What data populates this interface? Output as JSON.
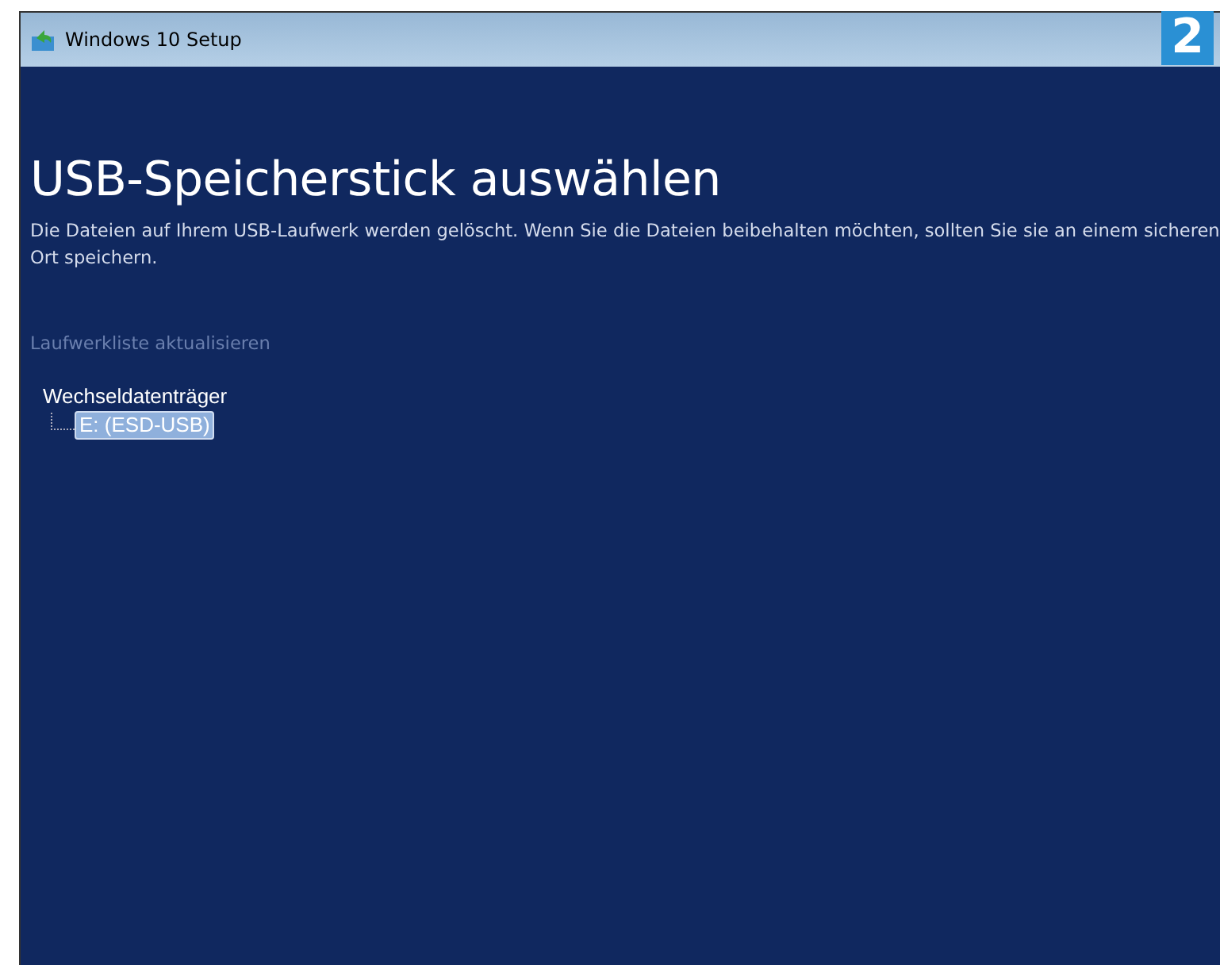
{
  "window": {
    "title": "Windows 10 Setup"
  },
  "badge": "2",
  "heading": "USB-Speicherstick auswählen",
  "description": "Die Dateien auf Ihrem USB-Laufwerk werden gelöscht. Wenn Sie die Dateien beibehalten möchten, sollten Sie sie an einem sicheren Ort speichern.",
  "refresh_link": {
    "label": "Laufwerkliste aktualisieren",
    "disabled": true
  },
  "tree": [
    {
      "label": "Wechseldatenträger",
      "selected": false,
      "children": [
        {
          "label": "E: (ESD-USB)",
          "selected": true
        }
      ]
    }
  ]
}
